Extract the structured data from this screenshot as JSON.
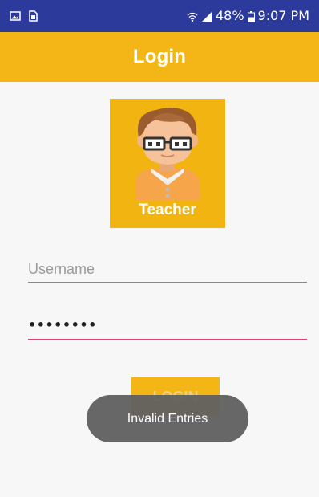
{
  "status_bar": {
    "battery_percent": "48%",
    "time": "9:07 PM",
    "icons": [
      "image-notification-icon",
      "sim-card-icon",
      "wifi-icon",
      "signal-icon",
      "battery-icon"
    ]
  },
  "app_bar": {
    "title": "Login"
  },
  "teacher_card": {
    "label": "Teacher",
    "icon": "teacher-avatar-icon"
  },
  "form": {
    "username": {
      "placeholder": "Username",
      "value": ""
    },
    "password": {
      "value": "••••••••"
    }
  },
  "login_button": {
    "label": "LOGIN"
  },
  "toast": {
    "message": "Invalid Entries"
  },
  "colors": {
    "status_bar": "#2b3a9b",
    "accent": "#f4b617",
    "password_underline": "#e03c78",
    "toast_bg": "#616161"
  }
}
